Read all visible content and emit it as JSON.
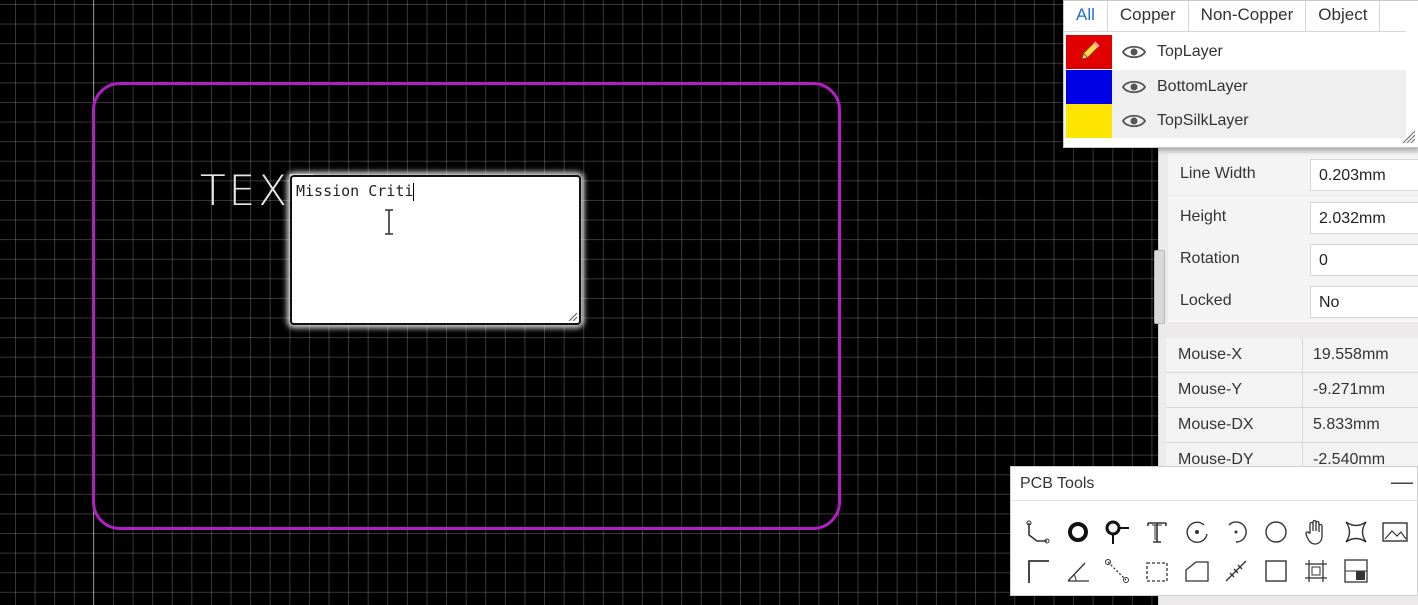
{
  "canvas": {
    "ghost_text": "TEXT",
    "editor_text": "Mission Criti",
    "board_color": "#b01fc4"
  },
  "layers_panel": {
    "tabs": [
      "All",
      "Copper",
      "Non-Copper",
      "Object"
    ],
    "active_tab": "All",
    "layers": [
      {
        "name": "TopLayer",
        "color": "#e00000",
        "active": true
      },
      {
        "name": "BottomLayer",
        "color": "#0000e6"
      },
      {
        "name": "TopSilkLayer",
        "color": "#ffe600"
      }
    ]
  },
  "properties": {
    "line_width": {
      "label": "Line Width",
      "value": "0.203mm"
    },
    "height": {
      "label": "Height",
      "value": "2.032mm"
    },
    "rotation": {
      "label": "Rotation",
      "value": "0"
    },
    "locked": {
      "label": "Locked",
      "value": "No"
    }
  },
  "mouse": [
    {
      "label": "Mouse-X",
      "value": "19.558mm"
    },
    {
      "label": "Mouse-Y",
      "value": "-9.271mm"
    },
    {
      "label": "Mouse-DX",
      "value": "5.833mm"
    },
    {
      "label": "Mouse-DY",
      "value": "-2.540mm"
    }
  ],
  "tools_panel": {
    "title": "PCB Tools",
    "minimize": "—",
    "row1": [
      "track-tool-icon",
      "pad-tool-icon",
      "via-tool-icon",
      "text-tool-icon",
      "arc-tool-icon",
      "center-arc-tool-icon",
      "circle-tool-icon",
      "pan-hand-icon",
      "hole-tool-icon",
      "image-tool-icon"
    ],
    "row2": [
      "dimension-tool-icon",
      "angle-tool-icon",
      "connect-tool-icon",
      "copper-area-tool-icon",
      "solid-region-tool-icon",
      "measure-tool-icon",
      "rect-tool-icon",
      "group-tool-icon",
      "table-tool-icon"
    ]
  }
}
